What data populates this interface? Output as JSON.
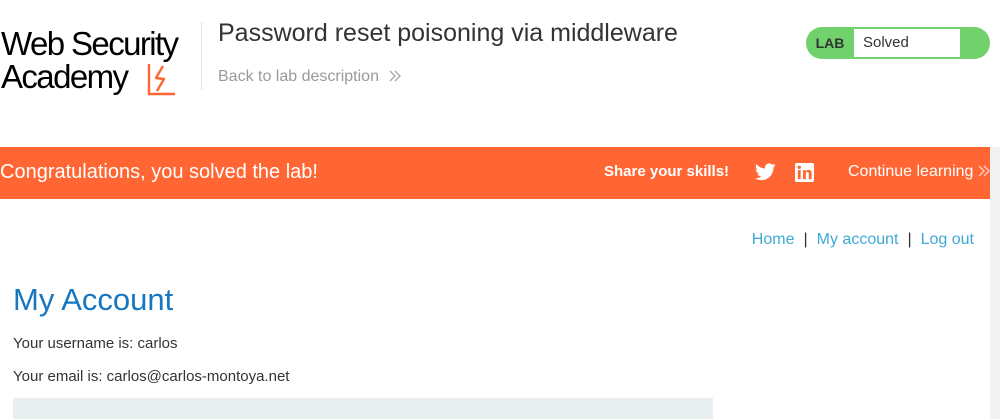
{
  "header": {
    "logo_line1": "Web Security",
    "logo_line2": "Academy",
    "lab_title": "Password reset poisoning via middleware",
    "back_link": "Back to lab description",
    "back_link_icon": "double-chevron-right",
    "lab_status": {
      "tag": "LAB",
      "state": "Solved",
      "color": "#70d16d"
    }
  },
  "banner": {
    "message": "Congratulations, you solved the lab!",
    "share_label": "Share your skills!",
    "share_icons": [
      "twitter-icon",
      "linkedin-icon"
    ],
    "continue_label": "Continue learning",
    "continue_icon": "double-chevron-right",
    "color": "#ff6633"
  },
  "nav": {
    "items": [
      "Home",
      "My account",
      "Log out"
    ],
    "separator": "|",
    "link_color": "#3fa9d6"
  },
  "account": {
    "heading": "My Account",
    "username_line": "Your username is: carlos",
    "email_line": "Your email is: carlos@carlos-montoya.net"
  }
}
